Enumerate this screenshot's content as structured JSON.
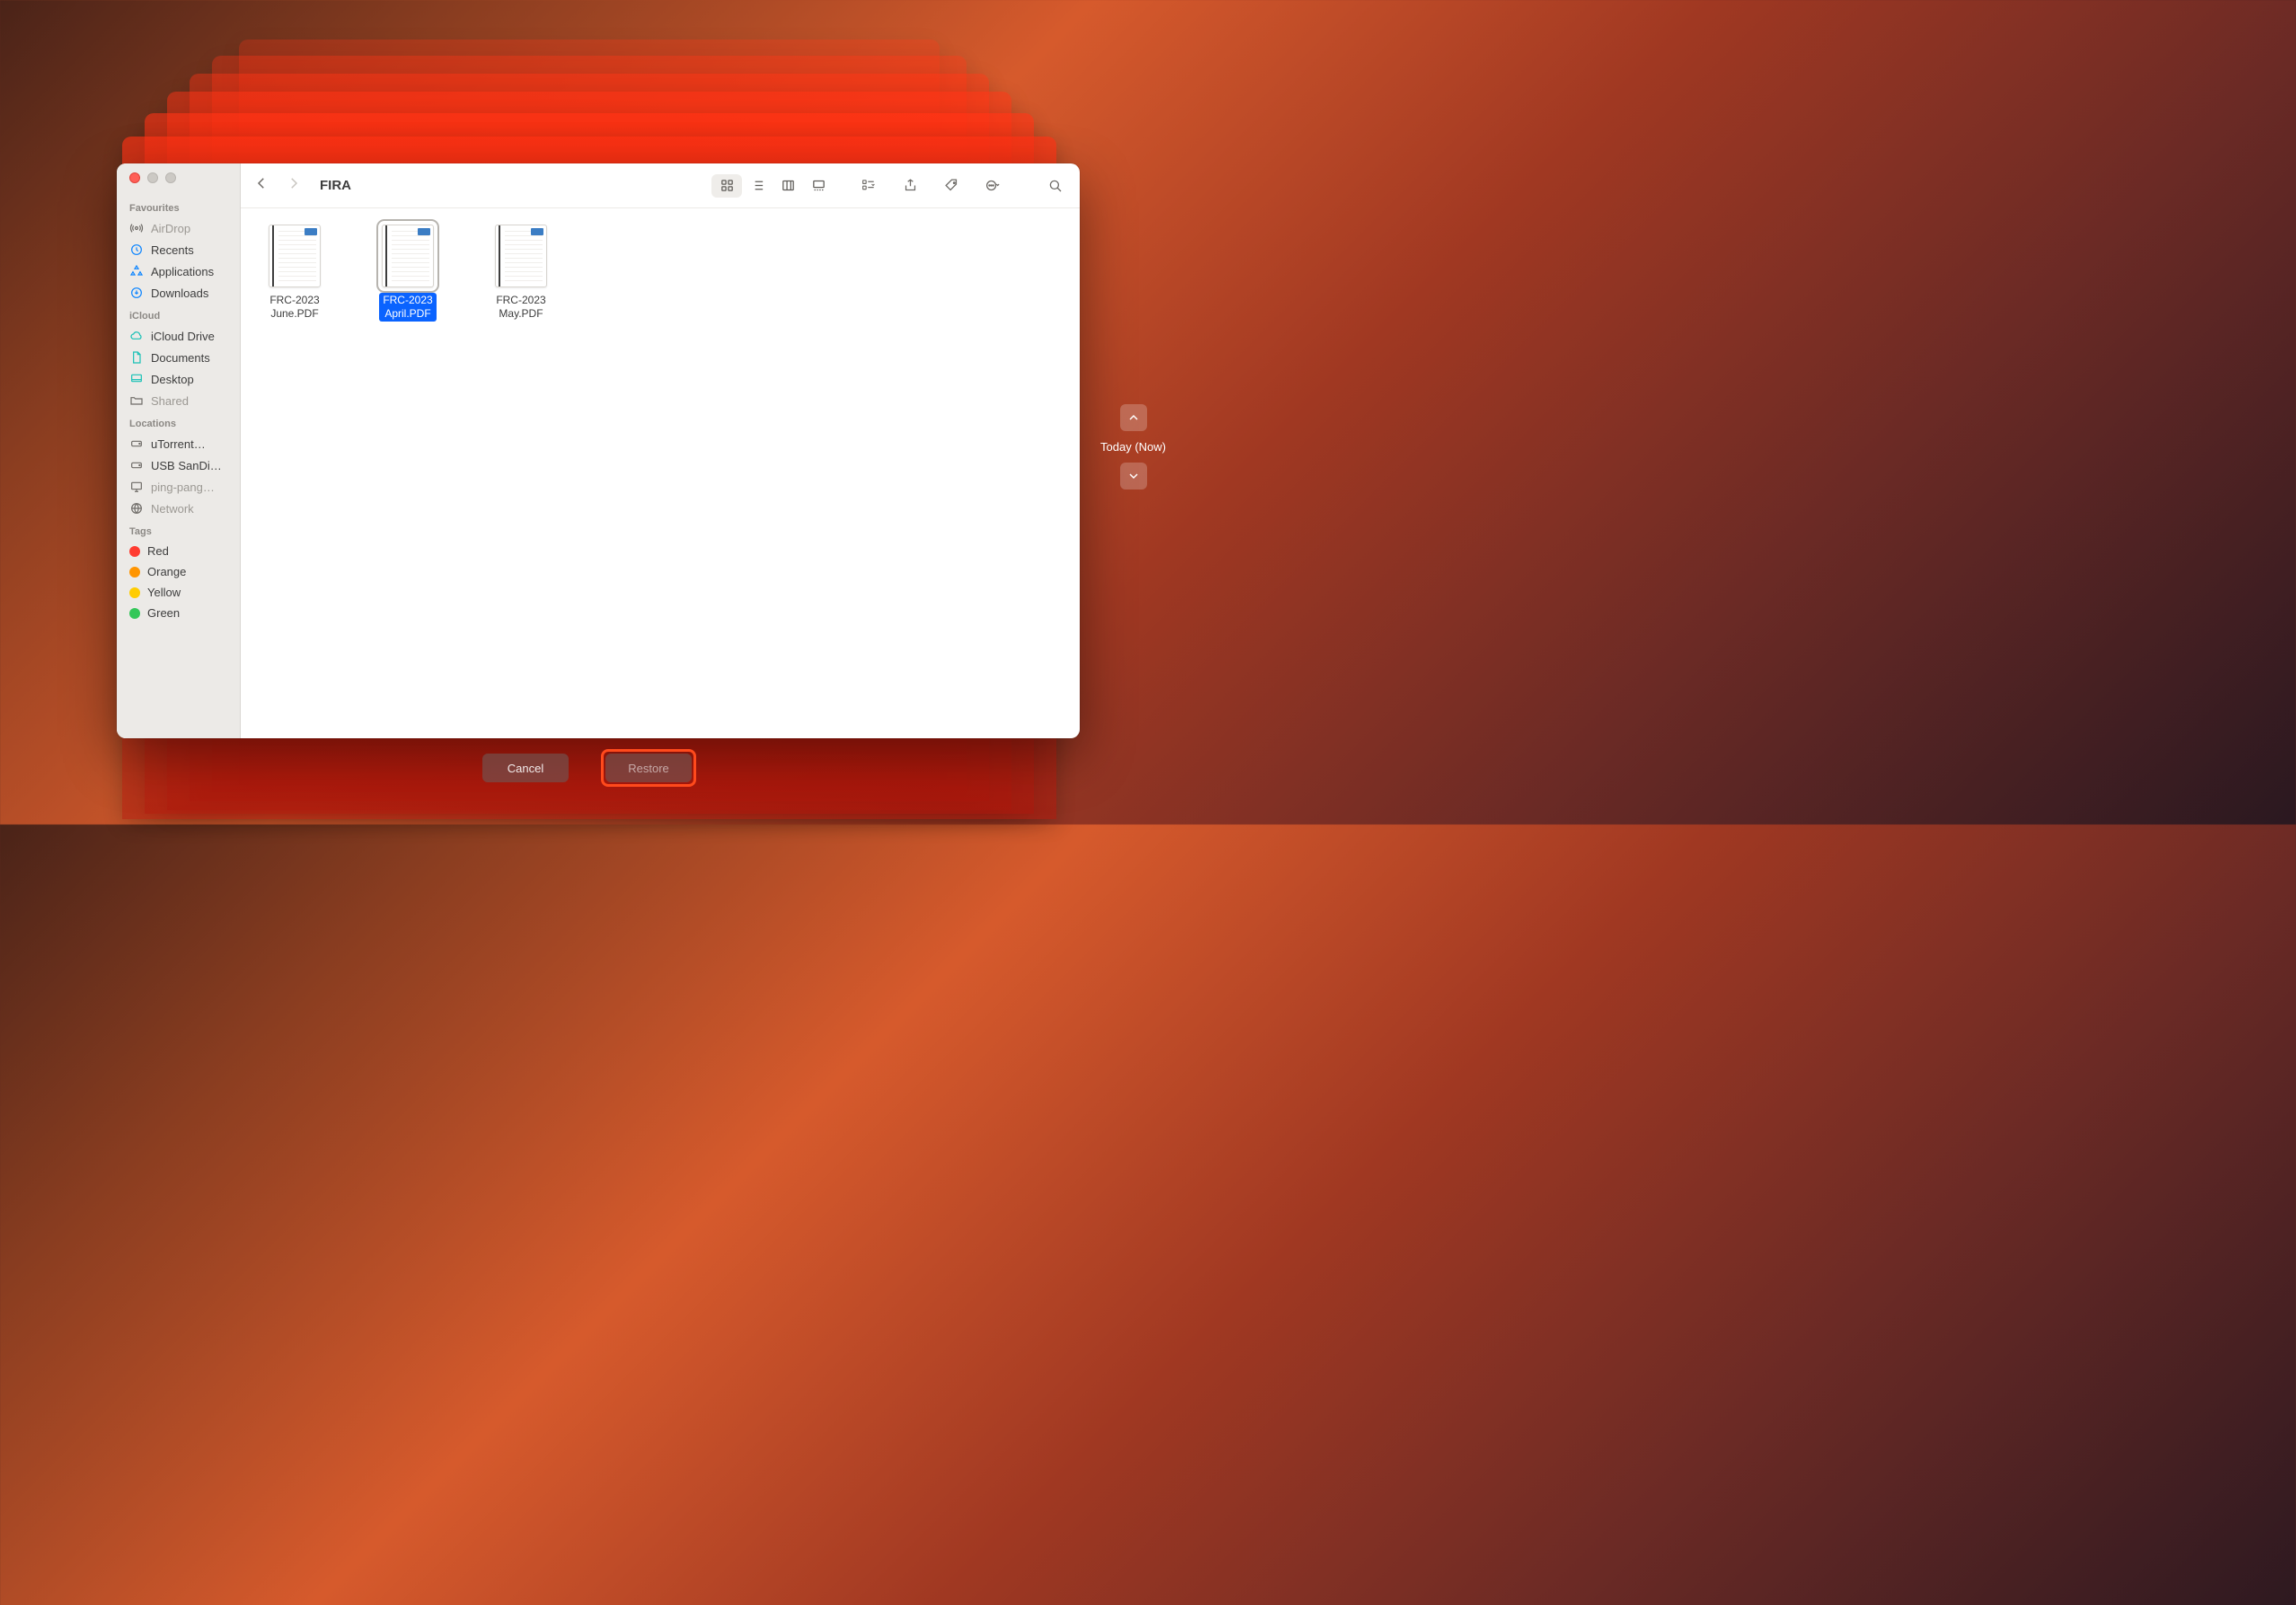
{
  "folder_title": "FIRA",
  "sidebar": {
    "sections": {
      "favourites": {
        "title": "Favourites",
        "items": [
          {
            "label": "AirDrop"
          },
          {
            "label": "Recents"
          },
          {
            "label": "Applications"
          },
          {
            "label": "Downloads"
          }
        ]
      },
      "icloud": {
        "title": "iCloud",
        "items": [
          {
            "label": "iCloud Drive"
          },
          {
            "label": "Documents"
          },
          {
            "label": "Desktop"
          },
          {
            "label": "Shared"
          }
        ]
      },
      "locations": {
        "title": "Locations",
        "items": [
          {
            "label": "uTorrent…"
          },
          {
            "label": "USB SanDi…"
          },
          {
            "label": "ping-pang…"
          },
          {
            "label": "Network"
          }
        ]
      },
      "tags": {
        "title": "Tags",
        "items": [
          {
            "label": "Red",
            "color": "#ff3b30"
          },
          {
            "label": "Orange",
            "color": "#ff9500"
          },
          {
            "label": "Yellow",
            "color": "#ffcc00"
          },
          {
            "label": "Green",
            "color": "#34c759"
          }
        ]
      }
    }
  },
  "files": [
    {
      "label_line1": "FRC-2023",
      "label_line2": "June.PDF",
      "selected": false
    },
    {
      "label_line1": "FRC-2023",
      "label_line2": "April.PDF",
      "selected": true
    },
    {
      "label_line1": "FRC-2023",
      "label_line2": "May.PDF",
      "selected": false
    }
  ],
  "timeline": {
    "label": "Today (Now)"
  },
  "buttons": {
    "cancel": "Cancel",
    "restore": "Restore"
  }
}
